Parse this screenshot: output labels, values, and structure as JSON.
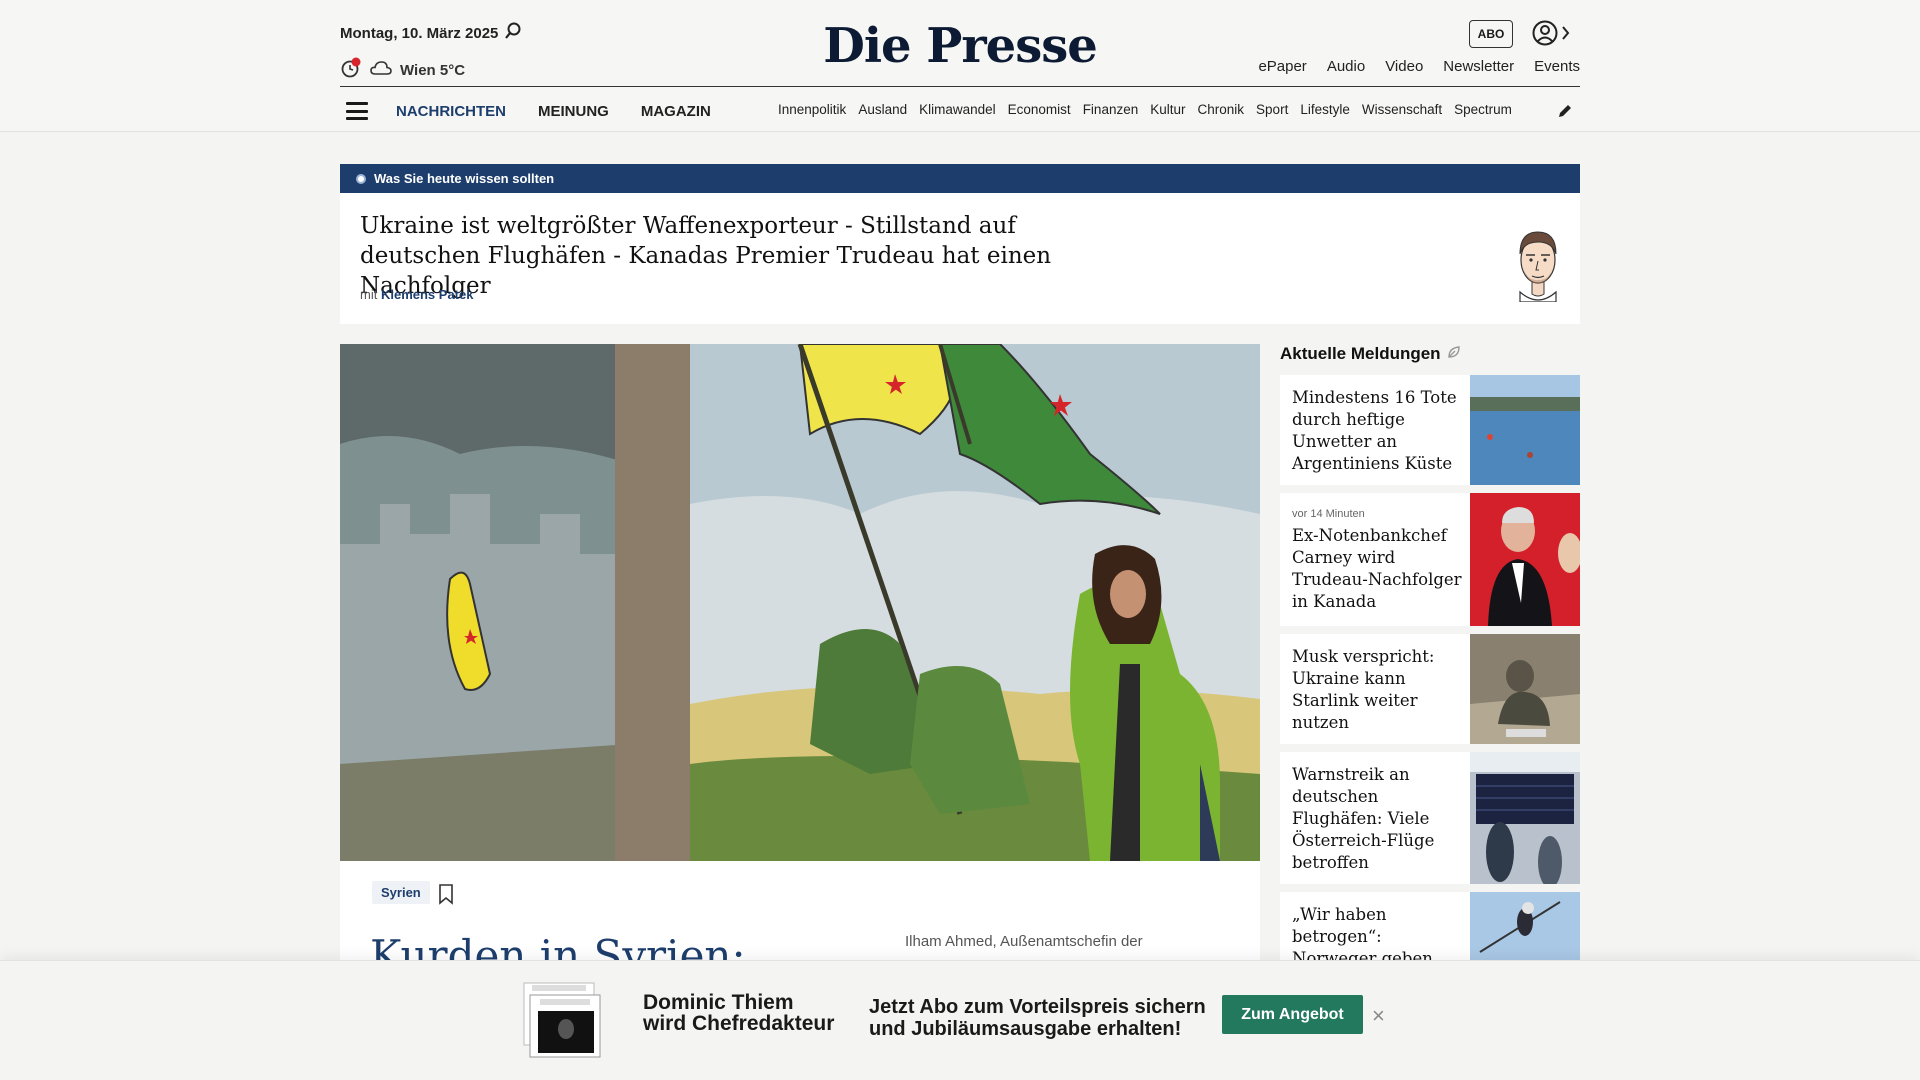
{
  "header": {
    "date": "Montag, 10. März 2025",
    "weather": "Wien 5°C",
    "logo": "Die Presse",
    "abo_label": "ABO",
    "top_links": [
      "ePaper",
      "Audio",
      "Video",
      "Newsletter",
      "Events"
    ],
    "main_nav": [
      "NACHRICHTEN",
      "MEINUNG",
      "MAGAZIN"
    ],
    "categories": [
      "Innenpolitik",
      "Ausland",
      "Klimawandel",
      "Economist",
      "Finanzen",
      "Kultur",
      "Chronik",
      "Sport",
      "Lifestyle",
      "Wissenschaft",
      "Spectrum"
    ]
  },
  "briefing": {
    "bar_label": "Was Sie heute wissen sollten",
    "headline": "Ukraine ist weltgrößter Waffenexporteur - Stillstand auf deutschen Flughäfen - Kanadas Premier Trudeau hat einen Nachfolger",
    "author_prefix": "mit",
    "author": "Klemens Patek"
  },
  "hero": {
    "tag": "Syrien",
    "title": "Kurden in Syrien:",
    "caption": "Ilham Ahmed, Außenamtschefin der"
  },
  "sidebar": {
    "title": "Aktuelle Meldungen",
    "items": [
      {
        "time": "",
        "text": "Mindestens 16 Tote durch heftige Unwetter an Argentiniens Küste"
      },
      {
        "time": "vor 14 Minuten",
        "text": "Ex-Notenbankchef Carney wird Trudeau-Nachfolger in Kanada"
      },
      {
        "time": "",
        "text": "Musk verspricht: Ukraine kann Starlink weiter nutzen"
      },
      {
        "time": "",
        "text": "Warnstreik an deutschen Flughäfen: Viele Österreich-Flüge betroffen"
      },
      {
        "time": "",
        "text": "„Wir haben betrogen“: Norweger geben Anzug-"
      }
    ]
  },
  "promo": {
    "name_line1": "Dominic Thiem",
    "name_line2": "wird Chefredakteur",
    "text_line1": "Jetzt Abo zum Vorteilspreis sichern",
    "text_line2": "und Jubiläumsausgabe erhalten!",
    "button": "Zum Angebot",
    "close": "×"
  },
  "colors": {
    "brand_blue": "#1d3e6d",
    "cta_green": "#23795d"
  }
}
